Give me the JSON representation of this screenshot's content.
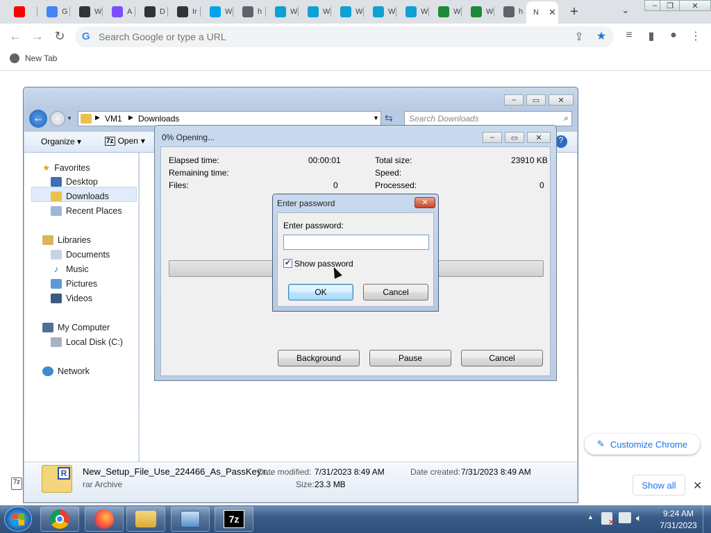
{
  "browser": {
    "tabs": [
      {
        "icon": "youtube-icon",
        "color": "#ff0000"
      },
      {
        "icon": "google-icon",
        "label": "G",
        "color": "#4285f4"
      },
      {
        "icon": "archive-icon",
        "label": "W",
        "color": "#333333"
      },
      {
        "icon": "app-icon",
        "label": "A",
        "color": "#7c4dff"
      },
      {
        "icon": "archive-icon",
        "label": "D",
        "color": "#333333"
      },
      {
        "icon": "archive-icon",
        "label": "Ir",
        "color": "#333333"
      },
      {
        "icon": "windows-icon",
        "label": "W",
        "color": "#00a4ef"
      },
      {
        "icon": "globe-icon",
        "label": "h",
        "color": "#5f6368"
      },
      {
        "icon": "edge-icon",
        "label": "W",
        "color": "#0fa0d4"
      },
      {
        "icon": "edge-icon",
        "label": "W",
        "color": "#0fa0d4"
      },
      {
        "icon": "edge-icon",
        "label": "W",
        "color": "#0fa0d4"
      },
      {
        "icon": "edge-icon",
        "label": "W",
        "color": "#0fa0d4"
      },
      {
        "icon": "edge-icon",
        "label": "W",
        "color": "#0fa0d4"
      },
      {
        "icon": "book-icon",
        "label": "W",
        "color": "#1b8a3a"
      },
      {
        "icon": "book-icon",
        "label": "W",
        "color": "#1b8a3a"
      },
      {
        "icon": "globe-icon",
        "label": "h",
        "color": "#5f6368"
      }
    ],
    "active_tab": {
      "label": "N"
    },
    "omnibox_placeholder": "Search Google or type a URL",
    "bookmark": "New Tab",
    "customize_label": "Customize Chrome",
    "show_all_label": "Show all"
  },
  "explorer": {
    "breadcrumb": [
      "VM1",
      "Downloads"
    ],
    "search_placeholder": "Search Downloads",
    "organize_label": "Organize",
    "open_label": "Open",
    "nav": {
      "favorites": "Favorites",
      "desktop": "Desktop",
      "downloads": "Downloads",
      "recent": "Recent Places",
      "libraries": "Libraries",
      "documents": "Documents",
      "music": "Music",
      "pictures": "Pictures",
      "videos": "Videos",
      "computer": "My Computer",
      "localdisk": "Local Disk (C:)",
      "network": "Network"
    },
    "file": {
      "name": "New_Setup_File_Use_224466_As_PassKey.r...",
      "type": "rar Archive",
      "date_modified_label": "Date modified:",
      "date_modified": "7/31/2023 8:49 AM",
      "date_created_label": "Date created:",
      "date_created": "7/31/2023 8:49 AM",
      "size_label": "Size:",
      "size": "23.3 MB"
    }
  },
  "opening": {
    "title": "0% Opening...",
    "elapsed_label": "Elapsed time:",
    "elapsed": "00:00:01",
    "remaining_label": "Remaining time:",
    "files_label": "Files:",
    "files": "0",
    "total_label": "Total size:",
    "total": "23910 KB",
    "speed_label": "Speed:",
    "processed_label": "Processed:",
    "processed": "0",
    "progress": 0,
    "background_btn": "Background",
    "pause_btn": "Pause",
    "cancel_btn": "Cancel"
  },
  "password_dialog": {
    "title": "Enter password",
    "prompt": "Enter password:",
    "value": "",
    "show_password_label": "Show password",
    "show_password_checked": true,
    "ok_btn": "OK",
    "cancel_btn": "Cancel"
  },
  "taskbar": {
    "time": "9:24 AM",
    "date": "7/31/2023",
    "apps": [
      "chrome-icon",
      "firefox-icon",
      "explorer-icon",
      "control-panel-icon",
      "7zip-icon"
    ],
    "sevenzip_label": "7z"
  }
}
